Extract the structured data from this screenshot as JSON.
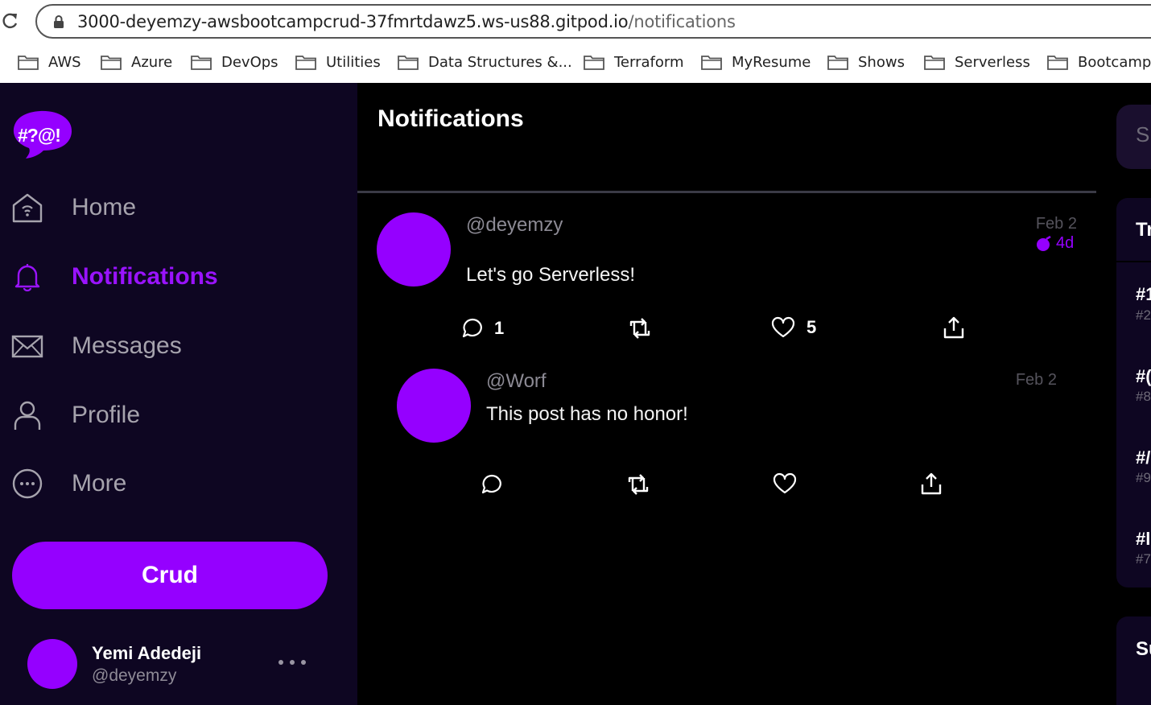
{
  "browser": {
    "url_host": "3000-deyemzy-awsbootcampcrud-37fmrtdawz5.ws-us88.gitpod.io",
    "url_path": "/notifications",
    "bookmarks": [
      "AWS",
      "Azure",
      "DevOps",
      "Utilities",
      "Data Structures &...",
      "Terraform",
      "MyResume",
      "Shows",
      "Serverless",
      "Bootcamp"
    ]
  },
  "sidebar": {
    "logo_text": "#?@!",
    "items": [
      {
        "label": "Home",
        "icon": "home-icon"
      },
      {
        "label": "Notifications",
        "icon": "bell-icon",
        "active": true
      },
      {
        "label": "Messages",
        "icon": "envelope-icon"
      },
      {
        "label": "Profile",
        "icon": "person-icon"
      },
      {
        "label": "More",
        "icon": "more-circle-icon"
      }
    ],
    "crud_label": "Crud",
    "user": {
      "name": "Yemi Adedeji",
      "handle": "@deyemzy"
    }
  },
  "main": {
    "title": "Notifications",
    "posts": [
      {
        "handle": "@deyemzy",
        "date": "Feb 2",
        "age": "4d",
        "message": "Let's go Serverless!",
        "replies": "1",
        "likes": "5"
      },
      {
        "handle": "@Worf",
        "date": "Feb 2",
        "message": "This post has no honor!"
      }
    ]
  },
  "right": {
    "search_fragment": "S",
    "trending_heading_fragment": "Tr",
    "trends": [
      {
        "tag": "#1",
        "sub": "#2"
      },
      {
        "tag": "#(",
        "sub": "#8"
      },
      {
        "tag": "#/",
        "sub": "#9"
      },
      {
        "tag": "#l",
        "sub": "#7"
      }
    ],
    "suggested_heading_fragment": "Su"
  },
  "colors": {
    "accent": "#9500ff",
    "sidebar_bg": "#0e0622",
    "main_bg": "#000000"
  }
}
